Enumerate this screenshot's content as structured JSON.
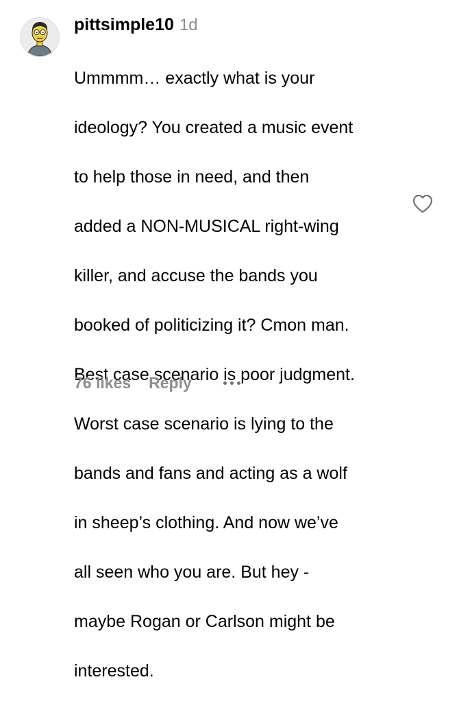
{
  "comment": {
    "username": "pittsimple10",
    "timestamp": "1d",
    "text_lines": [
      "Ummmm… exactly what is your",
      "ideology? You created a music event",
      "to help those in need, and then",
      "added a NON-MUSICAL right-wing",
      "killer, and accuse the bands you",
      "booked of politicizing it? Cmon man.",
      "Best case scenario is poor judgment.",
      "Worst case scenario is lying to the",
      "bands and fans and acting as a wolf",
      "in sheep’s clothing. And now we’ve",
      "all seen who you are. But hey -",
      "maybe Rogan or Carlson might be",
      "interested."
    ],
    "likes": "76 likes",
    "reply_label": "Reply",
    "avatar_icon": "cartoon-avatar-icon",
    "like_icon": "heart-outline-icon",
    "more_icon": "more-options-icon"
  },
  "colors": {
    "text": "#000000",
    "secondary": "#8e8e8e",
    "icon": "#737373",
    "background": "#ffffff"
  }
}
